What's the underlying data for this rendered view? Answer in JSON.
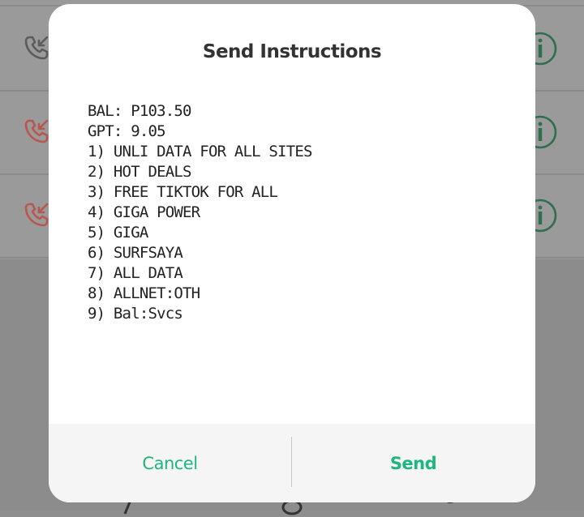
{
  "dialog": {
    "title": "Send Instructions",
    "message": "BAL: P103.50\nGPT: 9.05\n1) UNLI DATA FOR ALL SITES\n2) HOT DEALS\n3) FREE TIKTOK FOR ALL\n4) GIGA POWER\n5) GIGA\n6) SURFSAYA\n7) ALL DATA\n8) ALLNET:OTH\n9) Bal:Svcs",
    "cancel_label": "Cancel",
    "send_label": "Send"
  },
  "background": {
    "call_log": [
      {
        "call_type": "incoming-call-icon",
        "status_color": "#5c5c5c"
      },
      {
        "call_type": "missed-call-icon",
        "status_color": "#b8574f"
      },
      {
        "call_type": "missed-call-icon",
        "status_color": "#b8574f"
      }
    ],
    "info_icon": "info-icon"
  },
  "colors": {
    "accent": "#1fb57f",
    "missed_call": "#b8574f",
    "info_icon": "#2f6e4f"
  }
}
